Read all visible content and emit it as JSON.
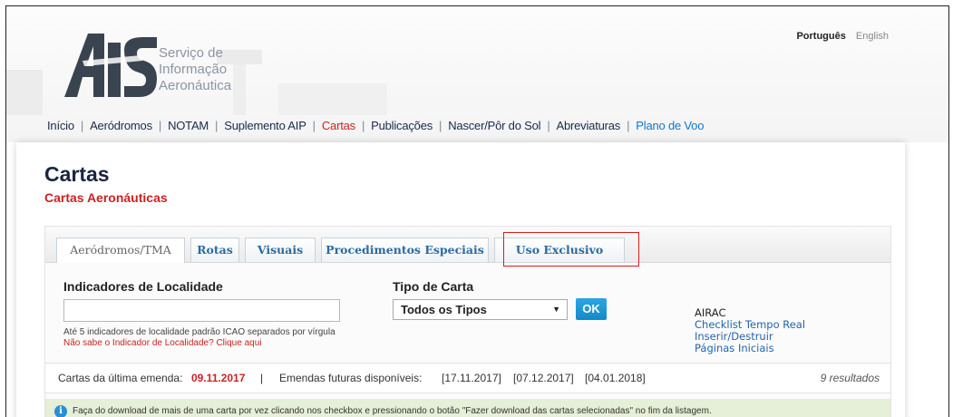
{
  "header": {
    "logo_text": [
      "Serviço de",
      "Informação",
      "Aeronáutica"
    ],
    "languages": [
      "Português",
      "English"
    ]
  },
  "nav": [
    "Início",
    "Aeródromos",
    "NOTAM",
    "Suplemento AIP",
    "Cartas",
    "Publicações",
    "Nascer/Pôr do Sol",
    "Abreviaturas",
    "Plano de Voo"
  ],
  "page": {
    "title": "Cartas",
    "subtitle": "Cartas Aeronáuticas"
  },
  "tabs": [
    "Aeródromos/TMA",
    "Rotas",
    "Visuais",
    "Procedimentos Especiais",
    "Uso Exclusivo"
  ],
  "form": {
    "locality_label": "Indicadores de Localidade",
    "locality_value": "",
    "locality_hint": "Até 5 indicadores de localidade padrão ICAO separados por vírgula",
    "locality_help_link": "Não sabe o Indicador de Localidade? Clique aqui",
    "chart_type_label": "Tipo de Carta",
    "chart_type_selected": "Todos os Tipos",
    "ok_label": "OK"
  },
  "airac": {
    "heading": "AIRAC",
    "links": [
      "Checklist Tempo Real",
      "Inserir/Destruir",
      "Páginas Iniciais"
    ]
  },
  "status": {
    "last_amendment_label": "Cartas da última emenda:",
    "last_amendment_date": "09.11.2017",
    "separator": "|",
    "future_label": "Emendas futuras disponíveis:",
    "future_dates": [
      "[17.11.2017]",
      "[07.12.2017]",
      "[04.01.2018]"
    ],
    "results": "9 resultados"
  },
  "info": {
    "text": "Faça do download de mais de uma carta por vez clicando nos checkbox e pressionando o botão \"Fazer download das cartas selecionadas\" no fim da listagem."
  },
  "colors": {
    "accent_red": "#cc2222",
    "link_blue": "#2266aa",
    "ok_blue": "#1a94d4",
    "info_bg": "#e6efd7"
  }
}
